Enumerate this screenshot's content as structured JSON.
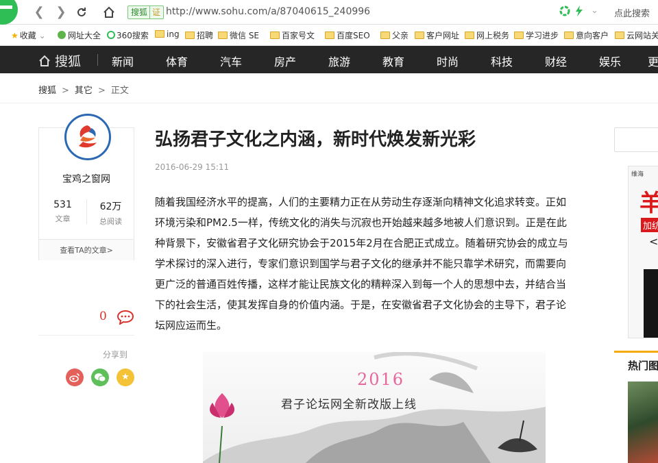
{
  "browser": {
    "url_badge": "搜狐",
    "url_badge_sub": "证",
    "url": "http://www.sohu.com/a/87040615_240996",
    "search_hint": "点此搜索"
  },
  "bookmarks": [
    {
      "label": "收藏",
      "icon": "star-icon"
    },
    {
      "label": "网址大全",
      "icon": "globe-icon"
    },
    {
      "label": "360搜索",
      "icon": "ring-icon"
    },
    {
      "label": "ing",
      "icon": "folder-icon"
    },
    {
      "label": "招聘",
      "icon": "folder-icon"
    },
    {
      "label": "微信 SE",
      "icon": "folder-icon"
    },
    {
      "label": "百家号文",
      "icon": "folder-icon"
    },
    {
      "label": "百度SEO",
      "icon": "folder-icon"
    },
    {
      "label": "父亲",
      "icon": "folder-icon"
    },
    {
      "label": "客户网址",
      "icon": "folder-icon"
    },
    {
      "label": "网上税务",
      "icon": "folder-icon"
    },
    {
      "label": "学习进步",
      "icon": "folder-icon"
    },
    {
      "label": "意向客户",
      "icon": "folder-icon"
    },
    {
      "label": "云网站关",
      "icon": "folder-icon"
    }
  ],
  "topnav": {
    "brand": "搜狐",
    "links": [
      "新闻",
      "体育",
      "汽车",
      "房产",
      "旅游",
      "教育",
      "时尚",
      "科技",
      "财经",
      "娱乐",
      "更"
    ]
  },
  "breadcrumb": {
    "home": "搜狐",
    "sep": ">",
    "category": "其它",
    "current": "正文"
  },
  "author": {
    "name": "宝鸡之窗网",
    "articles_num": "531",
    "articles_label": "文章",
    "reads_num": "62万",
    "reads_label": "总阅读",
    "link_label": "查看TA的文章>"
  },
  "comments": {
    "count": "0"
  },
  "share": {
    "label": "分享到"
  },
  "article": {
    "title": "弘扬君子文化之内涵，新时代焕发新光彩",
    "date": "2016-06-29 15:11",
    "lines": [
      "随着我国经济水平的提高，人们的主要精力正在从劳动生存逐渐向精神文化追求转变。正如",
      "环境污染和PM2.5一样，传统文化的消失与沉寂也开始越来越多地被人们意识到。正是在此",
      "种背景下，安徽省君子文化研究协会于2015年2月在合肥正式成立。随着研究协会的成立与",
      "学术探讨的深入进行，专家们意识到国学与君子文化的继承并不能只靠学术研究，而需要向",
      "更广泛的普通百姓传播，这样才能让民族文化的精粹深入到每一个人的思想中去，并结合当",
      "下的社会生活，使其发挥自身的价值内涵。于是，在安徽省君子文化协会的主导下，君子论",
      "坛网应运而生。"
    ],
    "image_year": "2016",
    "image_headline": "君子论坛网全新改版上线"
  },
  "right_rail": {
    "ad_top": "维海",
    "ad_big": "羊",
    "ad_tag": "加纺",
    "ad_lt": "<",
    "hot_title": "热门图"
  },
  "colors": {
    "topnav_bg": "#262626",
    "comment_red": "#d9322b",
    "weibo": "#e4605b",
    "wechat": "#5fbf5b",
    "favorite": "#f4c236",
    "rail_accent": "#f4a800"
  }
}
